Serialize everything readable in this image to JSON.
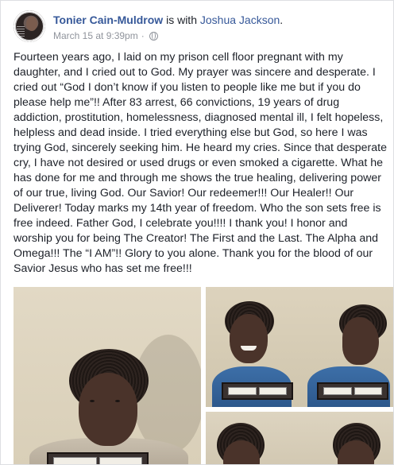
{
  "post": {
    "author": "Tonier Cain-Muldrow",
    "with_text": "is with",
    "tagged": "Joshua Jackson",
    "end_punct": ".",
    "timestamp": "March 15 at 9:39pm",
    "separator": "·",
    "privacy_icon": "globe-icon",
    "body": "Fourteen years ago, I laid on my prison cell floor pregnant with my daughter, and I cried out to God. My prayer was sincere and desperate. I cried out “God I don’t know if you listen to people like me but if you do please help me”!! After 83 arrest, 66 convictions, 19 years of drug addiction, prostitution, homelessness, diagnosed mental ill, I felt hopeless, helpless and dead inside. I tried everything else but God, so here I was trying God, sincerely seeking him. He heard my cries. Since that desperate cry, I have not desired or used drugs or even smoked a cigarette. What he has done for me and through me shows the true healing, delivering power of our true, living God. Our Savior! Our redeemer!!! Our Healer!! Our Deliverer! Today marks my 14th year of freedom. Who the son sets free is free indeed. Father God, I celebrate you!!!! I thank you! I honor and worship you for being The Creator! The First and the Last. The Alpha and Omega!!! The “I AM”!! Glory to you alone. Thank you for the blood of our Savior Jesus who has set me free!!!"
  },
  "photos": [
    {
      "name": "mugshot-front-large"
    },
    {
      "name": "mugshot-front-side-pair"
    },
    {
      "name": "mugshot-partial"
    }
  ],
  "colors": {
    "link": "#365899",
    "text": "#1d2129",
    "meta": "#90949c",
    "background": "#e9ebee"
  }
}
